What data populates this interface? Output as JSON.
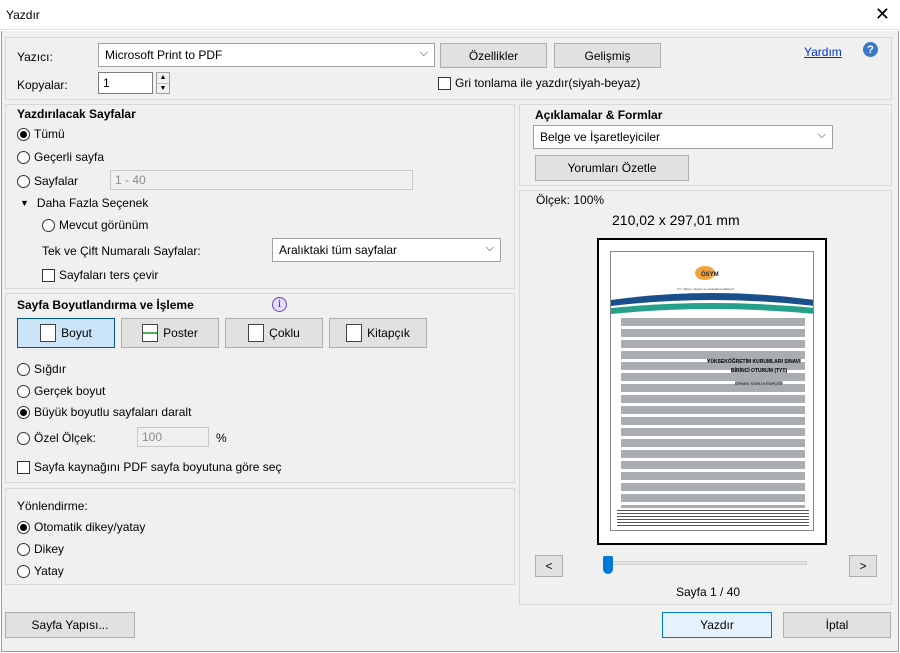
{
  "window": {
    "title": "Yazdır",
    "close_glyph": "✕"
  },
  "printer": {
    "label": "Yazıcı:",
    "value": "Microsoft Print to PDF",
    "properties_button": "Özellikler",
    "advanced_button": "Gelişmiş",
    "help_link": "Yardım",
    "help_icon": "question-circle-icon"
  },
  "copies": {
    "label": "Kopyalar:",
    "value": "1",
    "grayscale_label": "Gri tonlama ile yazdır(siyah-beyaz)",
    "grayscale_checked": false
  },
  "pages": {
    "title": "Yazdırılacak Sayfalar",
    "all": "Tümü",
    "current": "Geçerli sayfa",
    "range_label": "Sayfalar",
    "range_value": "1 - 40",
    "more_options": "Daha Fazla Seçenek",
    "current_view": "Mevcut görünüm",
    "odd_even_label": "Tek ve Çift Numaralı Sayfalar:",
    "odd_even_value": "Aralıktaki tüm sayfalar",
    "reverse_label": "Sayfaları ters çevir",
    "selected": "all"
  },
  "sizing": {
    "title": "Sayfa Boyutlandırma ve İşleme",
    "tabs": [
      "Boyut",
      "Poster",
      "Çoklu",
      "Kitapçık"
    ],
    "active_tab": "Boyut",
    "fit": "Sığdır",
    "actual": "Gerçek boyut",
    "shrink": "Büyük boyutlu sayfaları daralt",
    "custom_label": "Özel Ölçek:",
    "custom_value": "100",
    "percent": "%",
    "pdf_source_label": "Sayfa kaynağını PDF sayfa boyutuna göre seç",
    "selected": "shrink"
  },
  "orientation": {
    "title": "Yönlendirme:",
    "auto": "Otomatik dikey/yatay",
    "portrait": "Dikey",
    "landscape": "Yatay",
    "selected": "auto"
  },
  "comments": {
    "title": "Açıklamalar & Formlar",
    "value": "Belge ve İşaretleyiciler",
    "summarize_button": "Yorumları Özetle"
  },
  "preview": {
    "scale": "Ölçek: 100%",
    "dimensions": "210,02 x 297,01 mm",
    "page_indicator": "Sayfa 1 / 40",
    "prev_glyph": "<",
    "next_glyph": ">",
    "slider_position": 0.0,
    "doc_logo": "ÖSYM",
    "doc_subtitle": "T.C. Ölçme, Seçme ve Yerleştirme Merkezi",
    "doc_heading_1": "YÜKSEKÖĞRETİM KURUMLARI SINAVI",
    "doc_heading_2": "BİRİNCİ OTURUM (TYT)",
    "doc_heading_3": "ÖRNEK SORU KİTAPÇIĞI"
  },
  "footer": {
    "page_setup": "Sayfa Yapısı...",
    "print": "Yazdır",
    "cancel": "İptal"
  }
}
